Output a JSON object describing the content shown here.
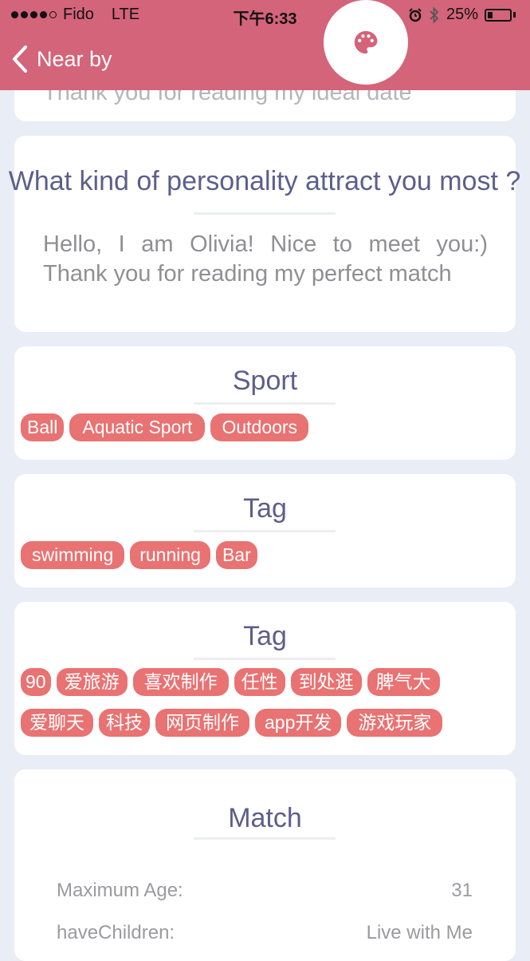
{
  "status_bar": {
    "carrier": "Fido",
    "network": "LTE",
    "time": "下午6:33",
    "battery": "25%"
  },
  "nav": {
    "back_label": "Near by"
  },
  "date_card": {
    "partial_text": "Thank you for reading my ideal date"
  },
  "personality_card": {
    "title": "What kind of personality attract you most ?",
    "body": "Hello, I am Olivia! Nice to meet you:) Thank you for reading my perfect match"
  },
  "sport_card": {
    "title": "Sport",
    "chips": [
      "Ball",
      "Aquatic Sport",
      "Outdoors"
    ]
  },
  "tag_card_1": {
    "title": "Tag",
    "chips": [
      "swimming",
      "running",
      "Bar"
    ]
  },
  "tag_card_2": {
    "title": "Tag",
    "chips": [
      "90",
      "爱旅游",
      "喜欢制作",
      "任性",
      "到处逛",
      "脾气大",
      "爱聊天",
      "科技",
      "网页制作",
      "app开发",
      "游戏玩家"
    ]
  },
  "match_card": {
    "title": "Match",
    "rows": [
      {
        "label": "Maximum Age:",
        "value": "31"
      },
      {
        "label": "haveChildren:",
        "value": "Live with Me"
      }
    ]
  },
  "colors": {
    "header": "#d4647a",
    "chip": "#e97272",
    "title": "#5c5f8a",
    "background": "#e9edf5"
  }
}
